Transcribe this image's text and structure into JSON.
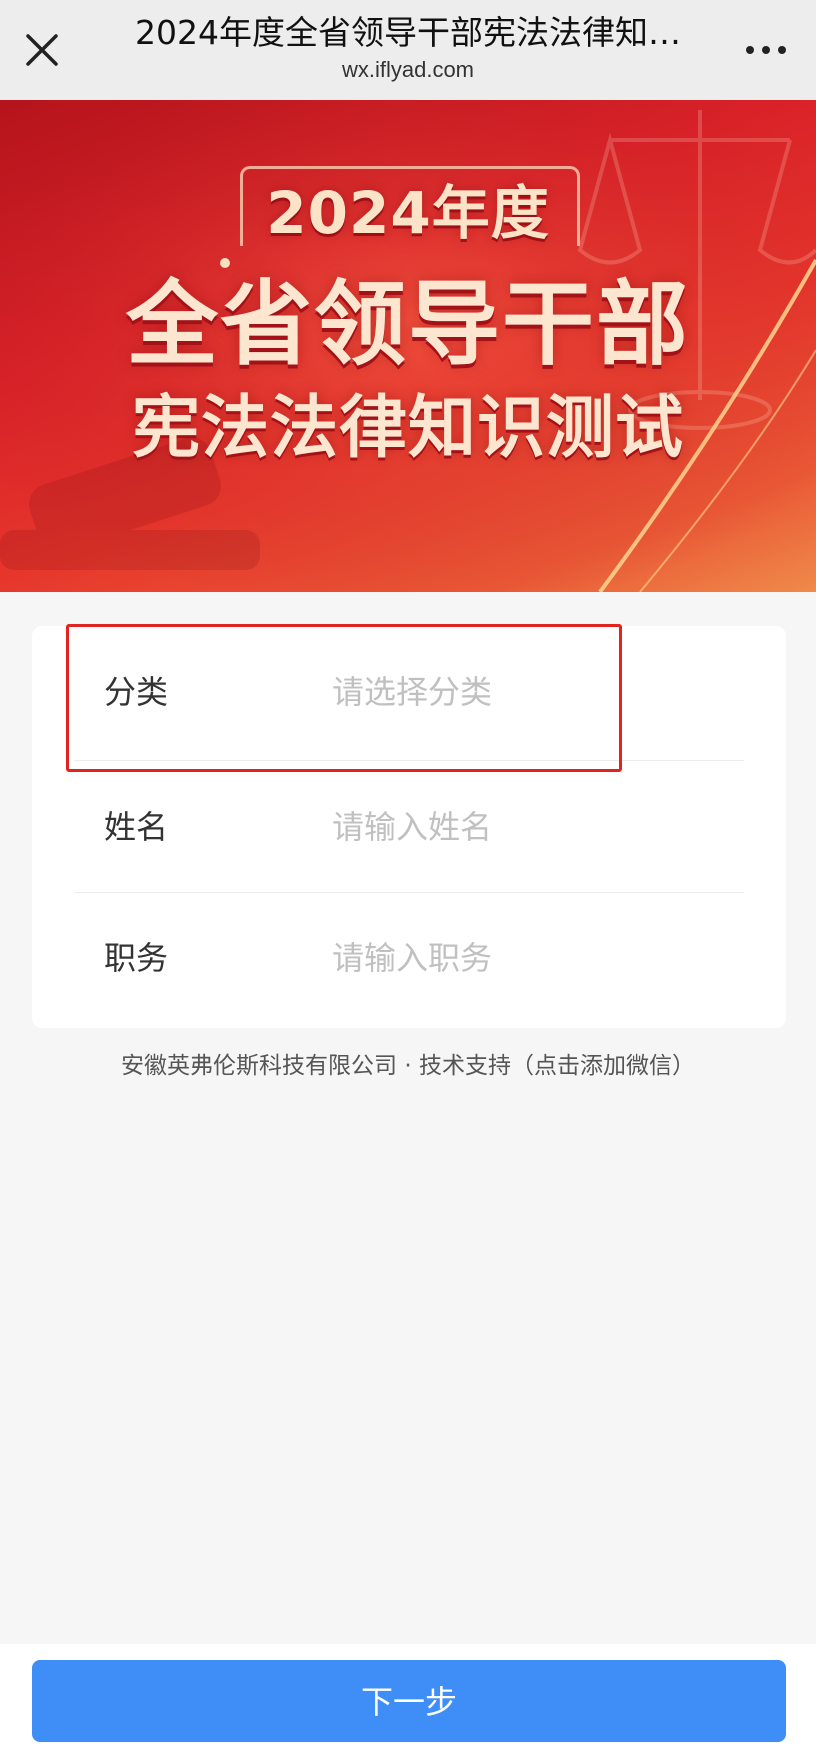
{
  "header": {
    "title": "2024年度全省领导干部宪法法律知…",
    "url": "wx.iflyad.com",
    "close_icon": "close-icon",
    "more_icon": "more-dots-icon"
  },
  "banner": {
    "line1": "2024年度",
    "line2": "全省领导干部",
    "line3": "宪法法律知识测试"
  },
  "form": {
    "rows": [
      {
        "label": "分类",
        "placeholder": "请选择分类",
        "kind": "select"
      },
      {
        "label": "姓名",
        "placeholder": "请输入姓名",
        "kind": "text"
      },
      {
        "label": "职务",
        "placeholder": "请输入职务",
        "kind": "text"
      }
    ]
  },
  "footer": {
    "support": "安徽英弗伦斯科技有限公司 · 技术支持（点击添加微信）"
  },
  "actions": {
    "next_label": "下一步"
  },
  "colors": {
    "primary_button": "#3f8ef7",
    "highlight": "#e0241f",
    "banner_red": "#d82128"
  }
}
